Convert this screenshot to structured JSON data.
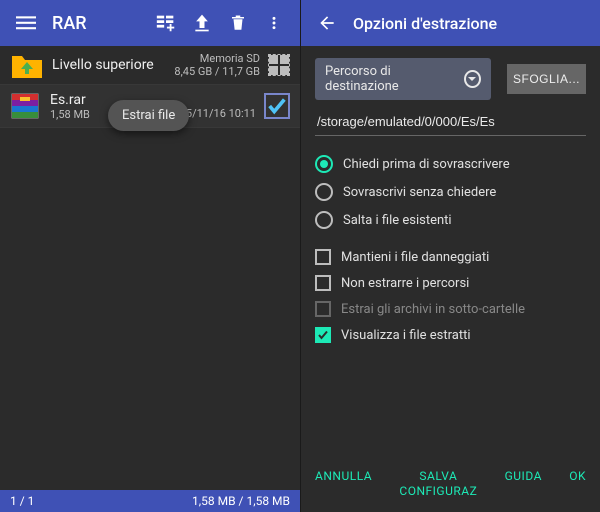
{
  "left": {
    "title": "RAR",
    "tooltip": "Estrai file",
    "parent": {
      "name": "Livello superiore",
      "storage_label": "Memoria SD",
      "storage_size": "8,45 GB / 11,7 GB"
    },
    "files": [
      {
        "name": "Es.rar",
        "size": "1,58 MB",
        "date": "15/11/16 10:11",
        "selected": true
      }
    ],
    "footer": {
      "count": "1 / 1",
      "size": "1,58 MB / 1,58 MB"
    }
  },
  "right": {
    "title": "Opzioni d'estrazione",
    "dest_label": "Percorso di destinazione",
    "browse": "SFOGLIA...",
    "path": "/storage/emulated/0/000/Es/Es",
    "radios": {
      "ask": "Chiedi prima di sovrascrivere",
      "overwrite": "Sovrascrivi senza chiedere",
      "skip": "Salta i file esistenti"
    },
    "checks": {
      "keep_broken": "Mantieni i file danneggiati",
      "no_paths": "Non estrarre i percorsi",
      "subfolders": "Estrai gli archivi in sotto-cartelle",
      "show_extracted": "Visualizza i file estratti"
    },
    "actions": {
      "cancel": "ANNULLA",
      "save": "SALVA CONFIGURAZ",
      "help": "GUIDA",
      "ok": "OK"
    }
  }
}
